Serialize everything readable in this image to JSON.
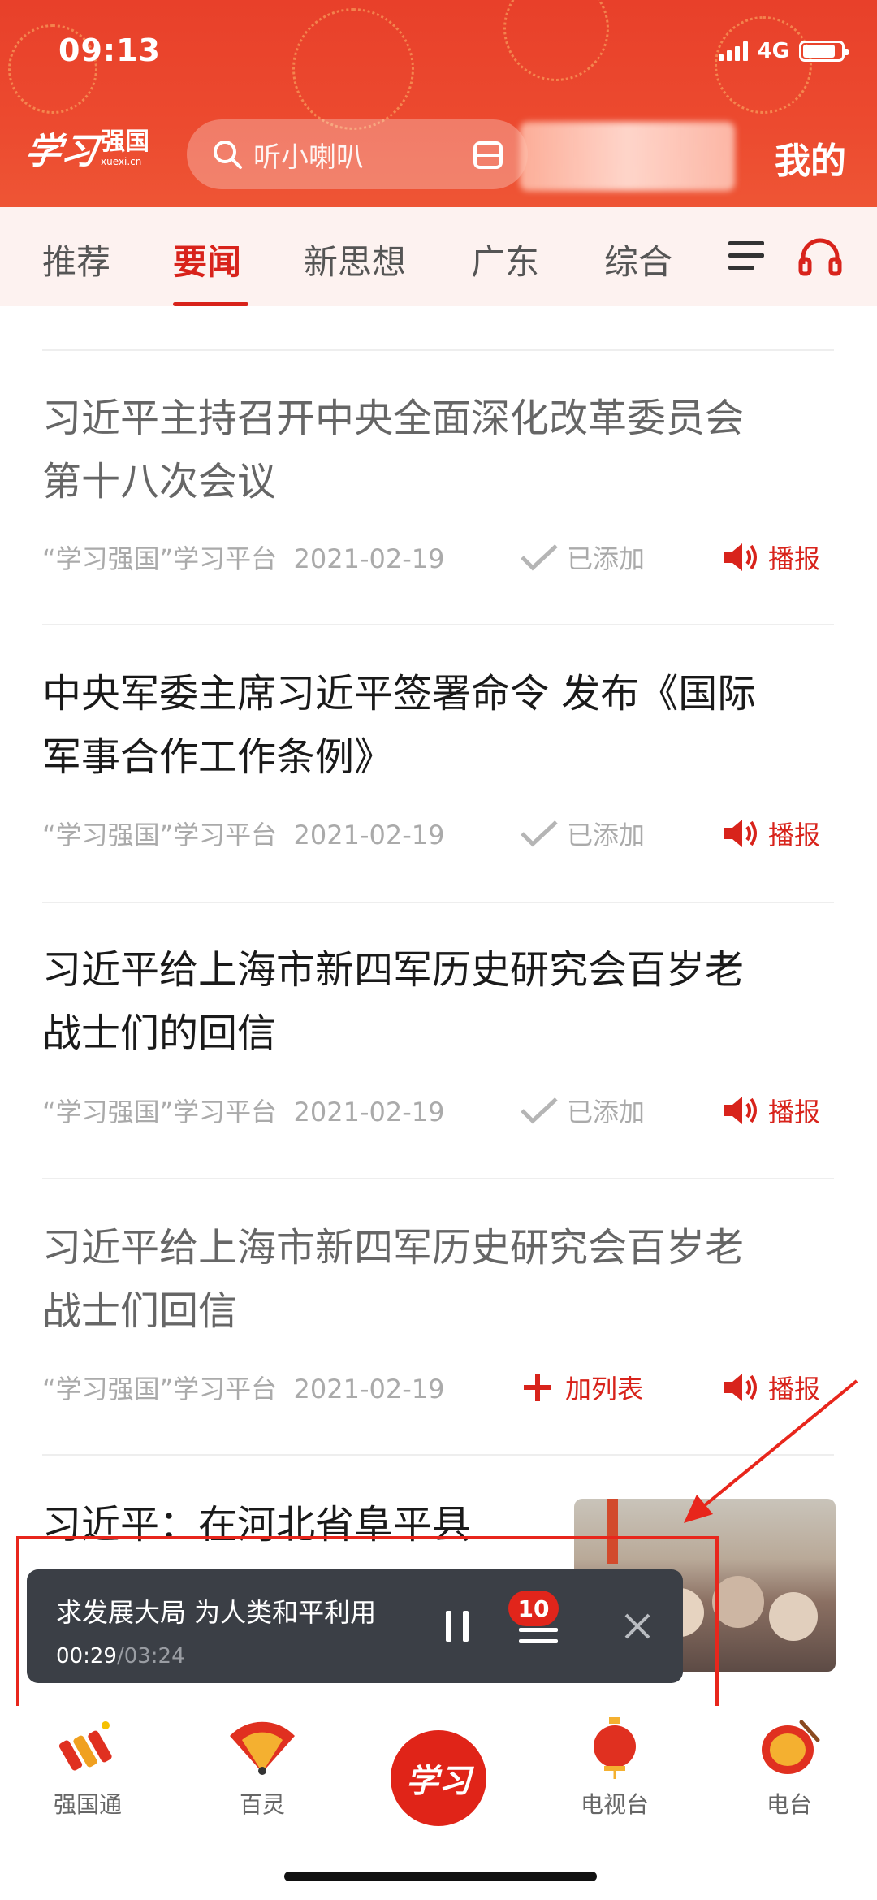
{
  "status_bar": {
    "time": "09:13",
    "network": "4G",
    "battery_level": 0.85
  },
  "header": {
    "logo_script": "学习",
    "logo_main": "强国",
    "logo_sub": "xuexi.cn",
    "search_placeholder": "听小喇叭",
    "mine_label": "我的"
  },
  "tabs": [
    {
      "label": "推荐",
      "active": false
    },
    {
      "label": "要闻",
      "active": true
    },
    {
      "label": "新思想",
      "active": false
    },
    {
      "label": "广东",
      "active": false
    },
    {
      "label": "综合",
      "active": false
    }
  ],
  "articles": [
    {
      "title_line1": "习近平主持召开中央全面深化改革委员会",
      "title_line2": "第十八次会议",
      "source": "“学习强国”学习平台",
      "date": "2021-02-19",
      "list_status": "已添加",
      "play_label": "播报",
      "read": true
    },
    {
      "title_line1": "中央军委主席习近平签署命令  发布《国际",
      "title_line2": "军事合作工作条例》",
      "source": "“学习强国”学习平台",
      "date": "2021-02-19",
      "list_status": "已添加",
      "play_label": "播报",
      "read": false
    },
    {
      "title_line1": "习近平给上海市新四军历史研究会百岁老",
      "title_line2": "战士们的回信",
      "source": "“学习强国”学习平台",
      "date": "2021-02-19",
      "list_status": "已添加",
      "play_label": "播报",
      "read": false
    },
    {
      "title_line1": "习近平给上海市新四军历史研究会百岁老",
      "title_line2": "战士们回信",
      "source": "“学习强国”学习平台",
      "date": "2021-02-19",
      "list_status": "加列表",
      "play_label": "播报",
      "read": true
    },
    {
      "title_line1": "习近平：在河北省阜平县",
      "title_line2": "",
      "read": false
    }
  ],
  "player": {
    "title": "求发展大局 为人类和平利用",
    "current_time": "00:29",
    "total_time": "03:24",
    "playlist_count": "10"
  },
  "bottom_nav": [
    {
      "label": "强国通"
    },
    {
      "label": "百灵"
    },
    {
      "label": "学习"
    },
    {
      "label": "电视台"
    },
    {
      "label": "电台"
    }
  ],
  "colors": {
    "brand_red": "#d8231b",
    "header_red": "#e8402a",
    "player_bg": "#3b3f46"
  }
}
